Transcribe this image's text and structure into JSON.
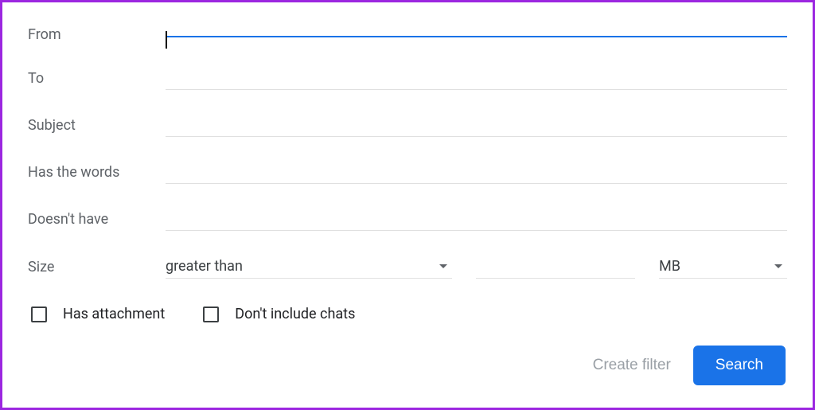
{
  "fields": {
    "from": {
      "label": "From",
      "value": ""
    },
    "to": {
      "label": "To",
      "value": ""
    },
    "subject": {
      "label": "Subject",
      "value": ""
    },
    "has_words": {
      "label": "Has the words",
      "value": ""
    },
    "doesnt_have": {
      "label": "Doesn't have",
      "value": ""
    },
    "size": {
      "label": "Size"
    }
  },
  "size_filter": {
    "comparator": "greater than",
    "value": "",
    "unit": "MB"
  },
  "checkboxes": {
    "has_attachment": {
      "label": "Has attachment",
      "checked": false
    },
    "dont_include_chats": {
      "label": "Don't include chats",
      "checked": false
    }
  },
  "buttons": {
    "create_filter": "Create filter",
    "search": "Search"
  }
}
